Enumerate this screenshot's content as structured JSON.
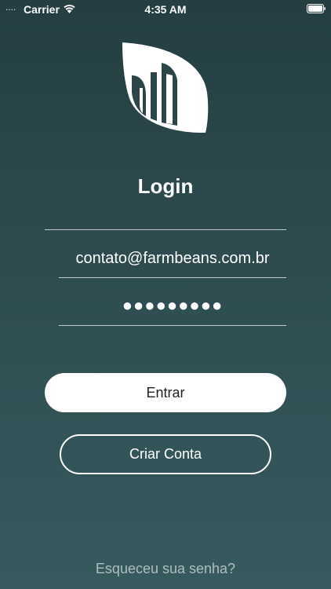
{
  "status_bar": {
    "signal_dots": "....",
    "carrier": "Carrier",
    "time": "4:35 AM",
    "wifi_icon": "wifi-icon",
    "battery_icon": "battery-icon"
  },
  "logo": {
    "icon": "farmbeans-leaf-logo"
  },
  "login": {
    "title": "Login",
    "email_value": "contato@farmbeans.com.br",
    "password_mask": "●●●●●●●●●",
    "submit_label": "Entrar",
    "create_account_label": "Criar Conta",
    "forgot_password_label": "Esqueceu sua senha?"
  },
  "colors": {
    "background_top": "#243e41",
    "background_bottom": "#365a5e",
    "primary_button": "#ffffff",
    "text": "#ffffff"
  }
}
